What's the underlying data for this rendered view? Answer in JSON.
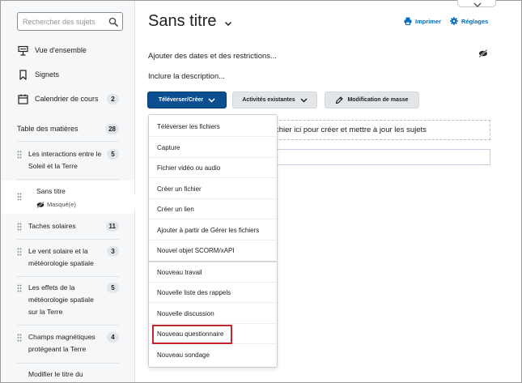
{
  "sidebar": {
    "search_placeholder": "Rechercher des sujets",
    "nav": [
      {
        "label": "Vue d'ensemble",
        "icon": "overview-icon"
      },
      {
        "label": "Signets",
        "icon": "bookmark-icon"
      },
      {
        "label": "Calendrier de cours",
        "icon": "calendar-icon",
        "badge": "2"
      }
    ],
    "toc": {
      "label": "Table des matières",
      "badge": "28"
    },
    "modules": [
      {
        "label": "Les interactions entre le Soleil et la Terre",
        "badge": "5"
      },
      {
        "label": "Sans titre",
        "hidden_label": "Masqué(e)"
      },
      {
        "label": "Taches solaires",
        "badge": "11"
      },
      {
        "label": "Le vent solaire et la météorologie spatiale",
        "badge": "3"
      },
      {
        "label": "Les effets de la météorologie spatiale sur la Terre",
        "badge": "5"
      },
      {
        "label": "Champs magnétiques protégeant la Terre",
        "badge": "4"
      },
      {
        "label": "Modifier le titre du"
      }
    ]
  },
  "main": {
    "title": "Sans titre",
    "print_label": "Imprimer",
    "settings_label": "Réglages",
    "add_dates_label": "Ajouter des dates et des restrictions...",
    "include_description_label": "Inclure la description...",
    "upload_create_label": "Téléverser/Créer",
    "existing_activities_label": "Activités existantes",
    "bulk_edit_label": "Modification de masse",
    "drop_zone_text": "chier ici pour créer et mettre à jour les sujets"
  },
  "dropdown": {
    "group1": [
      "Téléverser les fichiers",
      "Capture",
      "Fichier vidéo ou audio",
      "Créer un fichier",
      "Créer un lien",
      "Ajouter à partir de Gérer les fichiers",
      "Nouvel objet SCORM/xAPI"
    ],
    "group2": [
      "Nouveau travail",
      "Nouvelle liste des rappels",
      "Nouvelle discussion",
      "Nouveau questionnaire",
      "Nouveau sondage"
    ],
    "highlighted": "Nouveau questionnaire"
  },
  "colors": {
    "primary_button": "#0c4f90",
    "link": "#006fbf",
    "highlight_border": "#c0282d",
    "sidebar_bg": "#f6f7f8"
  }
}
